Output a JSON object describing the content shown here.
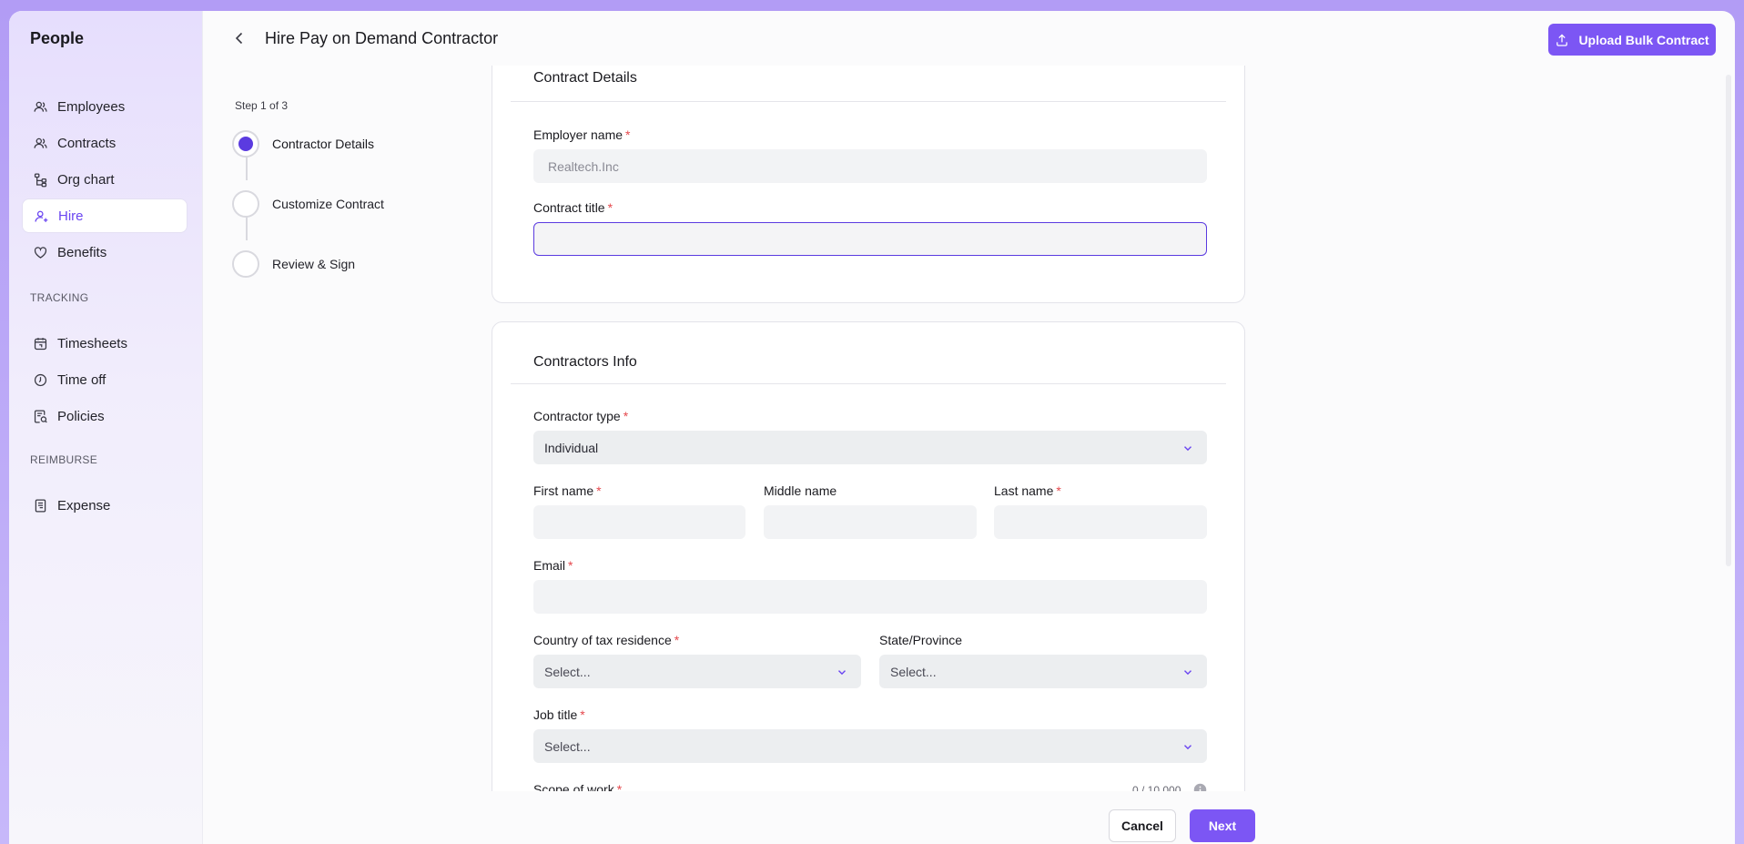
{
  "sidebar": {
    "brand": "People",
    "items": [
      {
        "label": "Employees",
        "icon": "users-icon"
      },
      {
        "label": "Contracts",
        "icon": "users-icon"
      },
      {
        "label": "Org chart",
        "icon": "org-chart-icon"
      },
      {
        "label": "Hire",
        "icon": "user-plus-icon",
        "active": true
      },
      {
        "label": "Benefits",
        "icon": "heart-icon"
      }
    ],
    "tracking_label": "TRACKING",
    "tracking_items": [
      {
        "label": "Timesheets",
        "icon": "calendar-icon"
      },
      {
        "label": "Time off",
        "icon": "clock-icon"
      },
      {
        "label": "Policies",
        "icon": "policy-icon"
      }
    ],
    "reimburse_label": "REIMBURSE",
    "reimburse_items": [
      {
        "label": "Expense",
        "icon": "receipt-icon"
      }
    ]
  },
  "header": {
    "title": "Hire Pay on Demand Contractor",
    "upload_label": "Upload Bulk Contract"
  },
  "stepper": {
    "count": "Step 1 of 3",
    "steps": [
      {
        "label": "Contractor Details",
        "active": true
      },
      {
        "label": "Customize Contract",
        "active": false
      },
      {
        "label": "Review & Sign",
        "active": false
      }
    ]
  },
  "contract_details": {
    "title": "Contract Details",
    "employer_label": "Employer name",
    "employer_value": "Realtech.Inc",
    "contract_title_label": "Contract title",
    "contract_title_value": ""
  },
  "contractors_info": {
    "title": "Contractors Info",
    "type_label": "Contractor type",
    "type_value": "Individual",
    "first_name_label": "First name",
    "middle_name_label": "Middle name",
    "last_name_label": "Last name",
    "email_label": "Email",
    "country_label": "Country of tax residence",
    "country_value": "Select...",
    "state_label": "State/Province",
    "state_value": "Select...",
    "job_title_label": "Job title",
    "job_title_value": "Select...",
    "scope_label": "Scope of work",
    "scope_counter": "0 / 10,000"
  },
  "footer": {
    "cancel_label": "Cancel",
    "next_label": "Next"
  },
  "colors": {
    "accent": "#7c56f4",
    "required": "#e5484d"
  }
}
